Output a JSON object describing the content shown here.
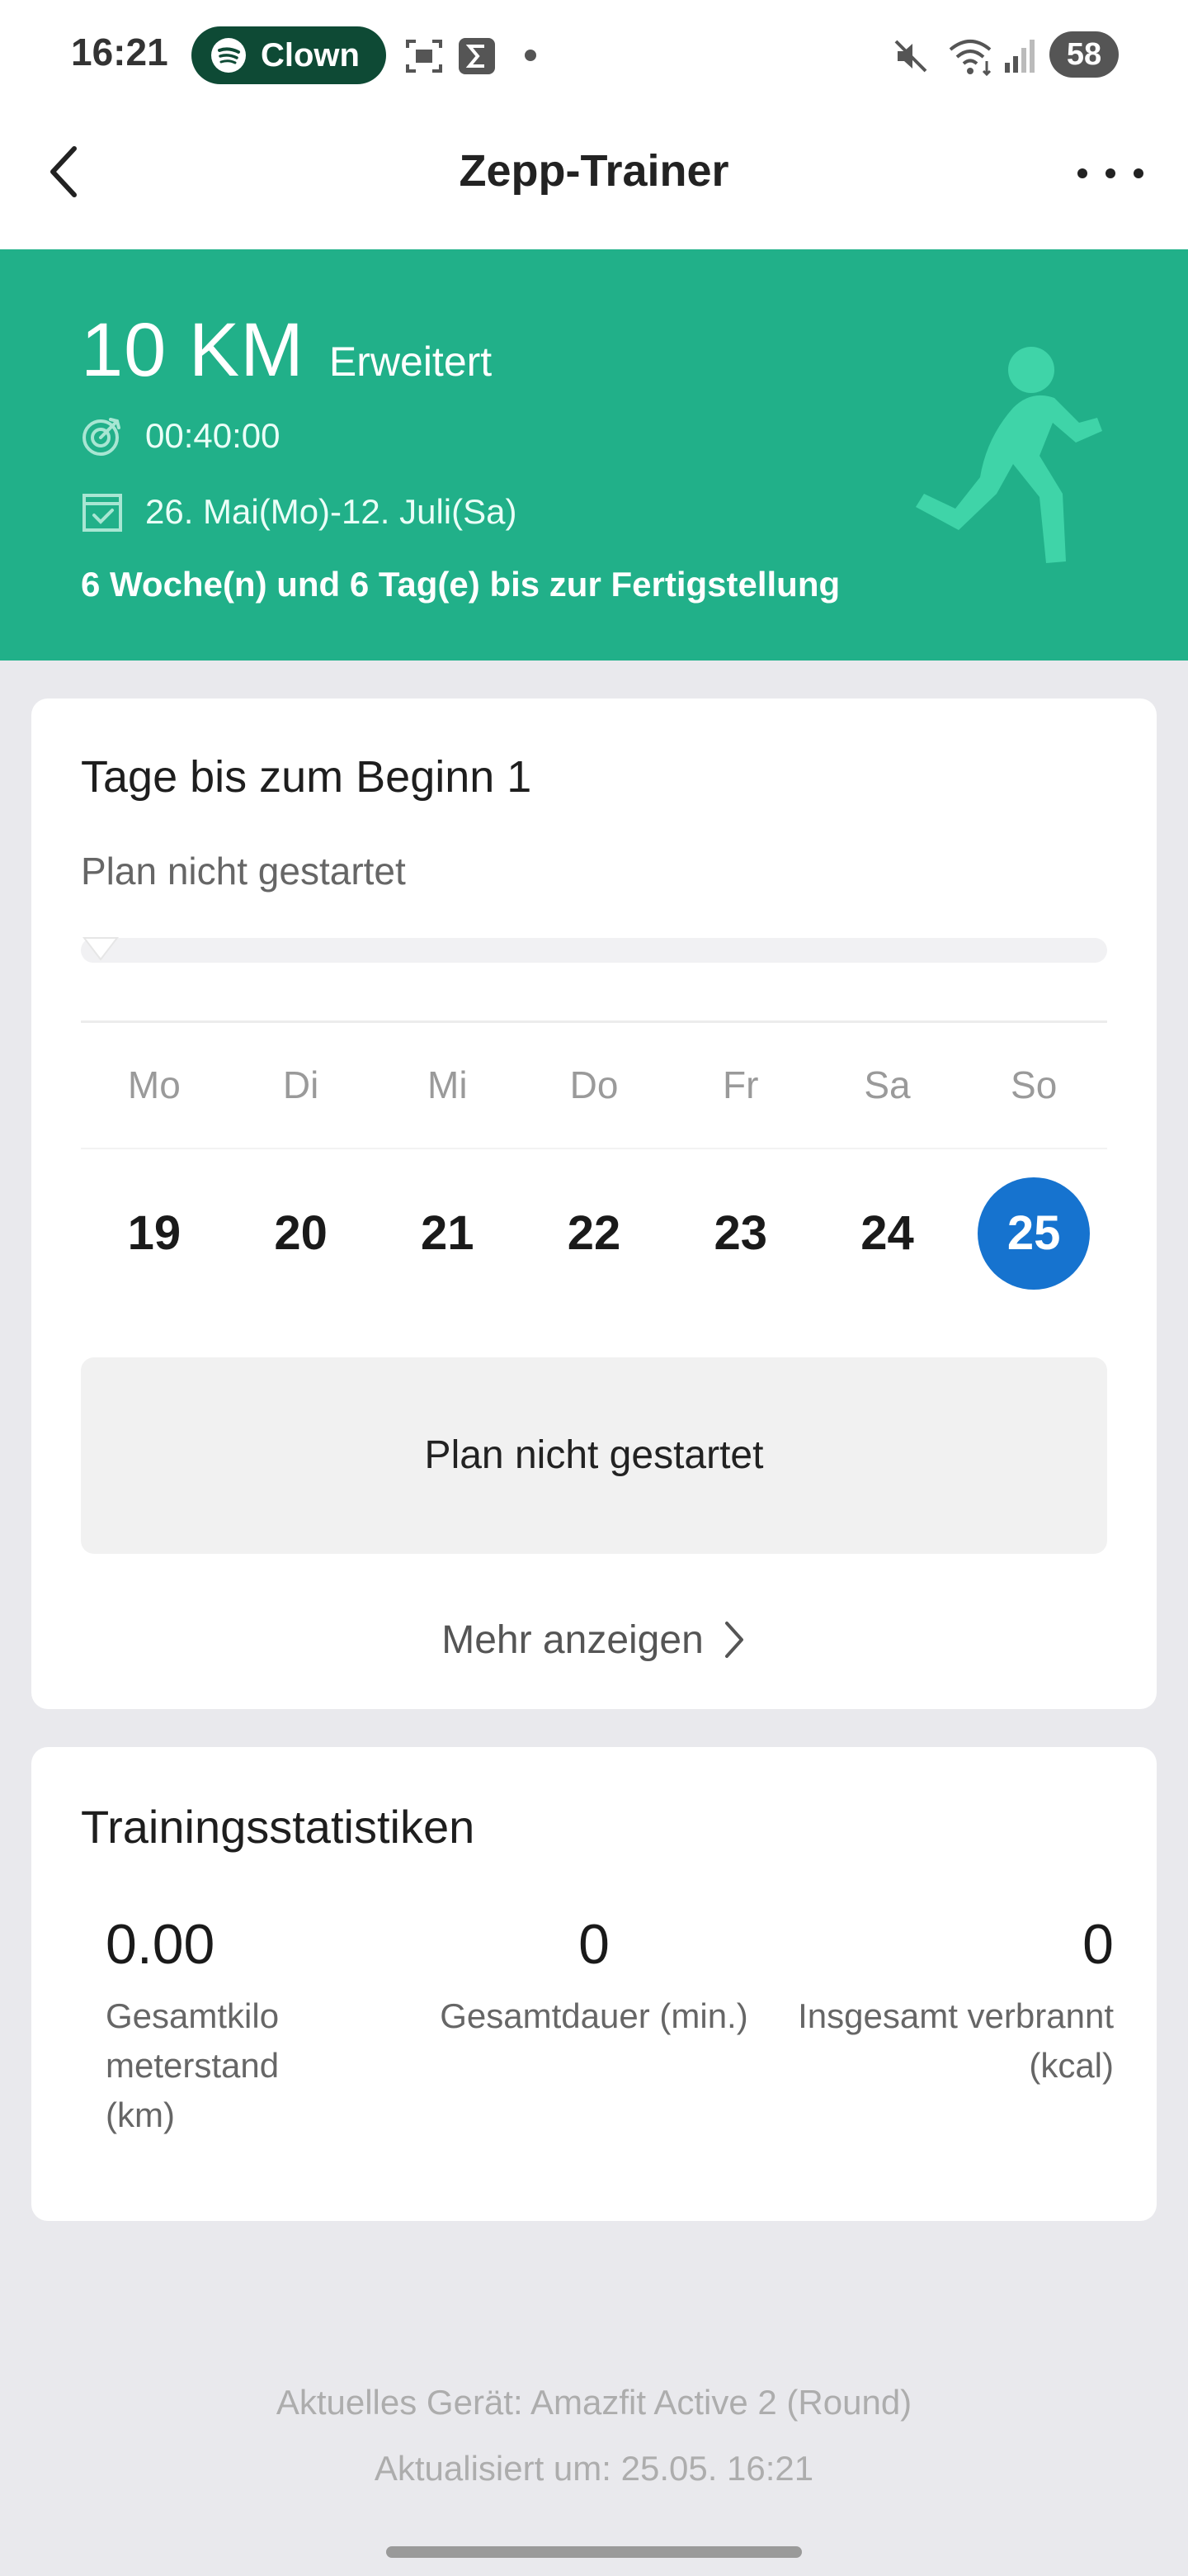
{
  "status_bar": {
    "time": "16:21",
    "media_app": "Clown",
    "battery": "58",
    "icons": [
      "spotify-icon",
      "screenshot-icon",
      "sigma-icon",
      "mute-icon",
      "wifi-icon",
      "signal-icon"
    ]
  },
  "header": {
    "title": "Zepp-Trainer",
    "back_icon": "back-arrow-icon",
    "more_icon": "more-dots-icon"
  },
  "banner": {
    "title": "10 KM",
    "level": "Erweitert",
    "target_time": "00:40:00",
    "date_range": "26. Mai(Mo)-12. Juli(Sa)",
    "summary": "6 Woche(n) und 6 Tag(e) bis zur Fertigstellung",
    "background_color": "#21b089"
  },
  "start_card": {
    "title": "Tage bis zum Beginn 1",
    "subtitle": "Plan nicht gestartet",
    "progress": 0,
    "weekdays": [
      "Mo",
      "Di",
      "Mi",
      "Do",
      "Fr",
      "Sa",
      "So"
    ],
    "dates": [
      "19",
      "20",
      "21",
      "22",
      "23",
      "24",
      "25"
    ],
    "selected_date": "25",
    "status_box": "Plan nicht gestartet",
    "more_link": "Mehr anzeigen"
  },
  "stats_card": {
    "title": "Trainingsstatistiken",
    "distance": {
      "value": "0.00",
      "label": "Gesamtkilo meterstand (km)"
    },
    "duration": {
      "value": "0",
      "label": "Gesamtdauer (min.)"
    },
    "calories": {
      "value": "0",
      "label": "Insgesamt verbrannt (kcal)"
    }
  },
  "footer": {
    "device": "Aktuelles Gerät: Amazfit Active 2 (Round)",
    "updated": "Aktualisiert um: 25.05. 16:21"
  },
  "colors": {
    "accent_green": "#21b089",
    "selected_blue": "#1673cf"
  }
}
